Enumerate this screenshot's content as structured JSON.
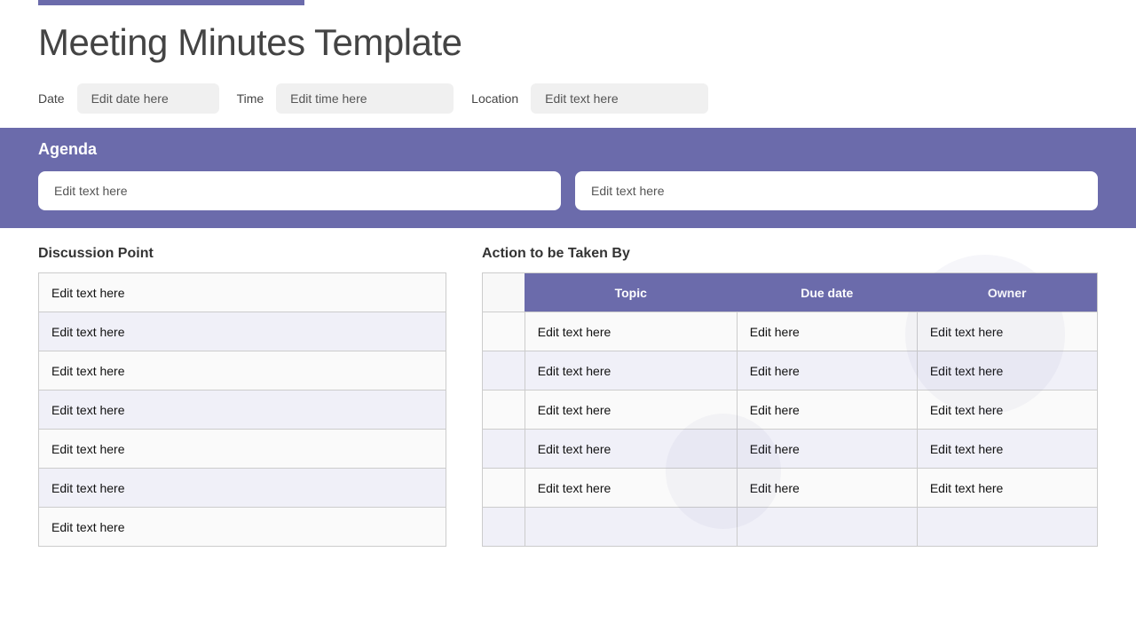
{
  "topBar": {},
  "header": {
    "title": "Meeting Minutes Template",
    "date_label": "Date",
    "date_placeholder": "Edit date here",
    "time_label": "Time",
    "time_placeholder": "Edit time here",
    "location_label": "Location",
    "location_placeholder": "Edit text here"
  },
  "agenda": {
    "title": "Agenda",
    "input1_placeholder": "Edit text here",
    "input2_placeholder": "Edit text here"
  },
  "discussion": {
    "heading": "Discussion Point",
    "rows": [
      {
        "text": "Edit text here"
      },
      {
        "text": "Edit text here"
      },
      {
        "text": "Edit text here"
      },
      {
        "text": "Edit text here"
      },
      {
        "text": "Edit text here"
      },
      {
        "text": "Edit text here"
      },
      {
        "text": "Edit text here"
      }
    ]
  },
  "action": {
    "heading": "Action to be Taken By",
    "col_topic": "Topic",
    "col_due": "Due date",
    "col_owner": "Owner",
    "rows": [
      {
        "topic": "Edit text here",
        "due": "Edit here",
        "owner": "Edit text here"
      },
      {
        "topic": "Edit text here",
        "due": "Edit here",
        "owner": "Edit text here"
      },
      {
        "topic": "Edit text here",
        "due": "Edit here",
        "owner": "Edit text here"
      },
      {
        "topic": "Edit text here",
        "due": "Edit here",
        "owner": "Edit text here"
      },
      {
        "topic": "Edit text here",
        "due": "Edit here",
        "owner": "Edit text here"
      },
      {
        "topic": "",
        "due": "",
        "owner": ""
      }
    ]
  }
}
